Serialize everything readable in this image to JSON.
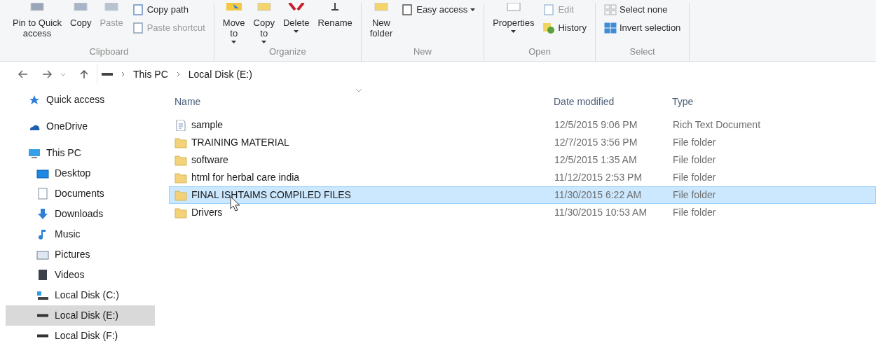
{
  "ribbon": {
    "groups": [
      {
        "label": "Clipboard",
        "items": [
          {
            "kind": "large",
            "lines": [
              "Pin to Quick",
              "access"
            ],
            "disabled": false,
            "dropdown": false
          },
          {
            "kind": "large",
            "lines": [
              "Copy"
            ],
            "disabled": false,
            "dropdown": false
          },
          {
            "kind": "large",
            "lines": [
              "Paste"
            ],
            "disabled": true,
            "dropdown": false
          },
          {
            "kind": "small",
            "lines": [
              "Copy path"
            ],
            "disabled": false,
            "dropdown": false
          },
          {
            "kind": "small",
            "lines": [
              "Paste shortcut"
            ],
            "disabled": true,
            "dropdown": false
          }
        ]
      },
      {
        "label": "Organize",
        "items": [
          {
            "kind": "large",
            "lines": [
              "Move",
              "to"
            ],
            "disabled": false,
            "dropdown": true
          },
          {
            "kind": "large",
            "lines": [
              "Copy",
              "to"
            ],
            "disabled": false,
            "dropdown": true
          },
          {
            "kind": "large",
            "lines": [
              "Delete"
            ],
            "disabled": false,
            "dropdown": true
          },
          {
            "kind": "large",
            "lines": [
              "Rename"
            ],
            "disabled": false,
            "dropdown": false
          }
        ]
      },
      {
        "label": "New",
        "items": [
          {
            "kind": "large",
            "lines": [
              "New",
              "folder"
            ],
            "disabled": false,
            "dropdown": false
          },
          {
            "kind": "small",
            "lines": [
              "Easy access"
            ],
            "disabled": false,
            "dropdown": true
          }
        ]
      },
      {
        "label": "Open",
        "items": [
          {
            "kind": "large",
            "lines": [
              "Properties"
            ],
            "disabled": false,
            "dropdown": true
          },
          {
            "kind": "small",
            "lines": [
              "Edit"
            ],
            "disabled": true,
            "dropdown": false
          },
          {
            "kind": "small",
            "lines": [
              "History"
            ],
            "disabled": false,
            "dropdown": false
          }
        ]
      },
      {
        "label": "Select",
        "items": [
          {
            "kind": "small",
            "lines": [
              "Select none"
            ],
            "disabled": false,
            "dropdown": false
          },
          {
            "kind": "small",
            "lines": [
              "Invert selection"
            ],
            "disabled": false,
            "dropdown": false
          }
        ]
      }
    ]
  },
  "address": {
    "crumbs": [
      "This PC",
      "Local Disk (E:)"
    ]
  },
  "sidebar": {
    "items": [
      {
        "label": "Quick access",
        "selected": false
      },
      {
        "label": "OneDrive",
        "selected": false
      },
      {
        "label": "This PC",
        "selected": false,
        "children": [
          {
            "label": "Desktop",
            "selected": false
          },
          {
            "label": "Documents",
            "selected": false
          },
          {
            "label": "Downloads",
            "selected": false
          },
          {
            "label": "Music",
            "selected": false
          },
          {
            "label": "Pictures",
            "selected": false
          },
          {
            "label": "Videos",
            "selected": false
          },
          {
            "label": "Local Disk (C:)",
            "selected": false
          },
          {
            "label": "Local Disk (E:)",
            "selected": true
          },
          {
            "label": "Local Disk (F:)",
            "selected": false
          }
        ]
      }
    ]
  },
  "table": {
    "columns": [
      "Name",
      "Date modified",
      "Type"
    ],
    "rows": [
      {
        "kind": "file",
        "name": "sample",
        "date": "12/5/2015 9:06 PM",
        "type": "Rich Text Document",
        "selected": false
      },
      {
        "kind": "folder",
        "name": "TRAINING MATERIAL",
        "date": "12/7/2015 3:56 PM",
        "type": "File folder",
        "selected": false
      },
      {
        "kind": "folder",
        "name": "software",
        "date": "12/5/2015 1:35 AM",
        "type": "File folder",
        "selected": false
      },
      {
        "kind": "folder",
        "name": "html for herbal care india",
        "date": "11/12/2015 2:53 PM",
        "type": "File folder",
        "selected": false
      },
      {
        "kind": "folder",
        "name": "FINAL ISHTAIMS COMPILED FILES",
        "date": "11/30/2015 6:22 AM",
        "type": "File folder",
        "selected": true
      },
      {
        "kind": "folder",
        "name": "Drivers",
        "date": "11/30/2015 10:53 AM",
        "type": "File folder",
        "selected": false
      }
    ]
  }
}
